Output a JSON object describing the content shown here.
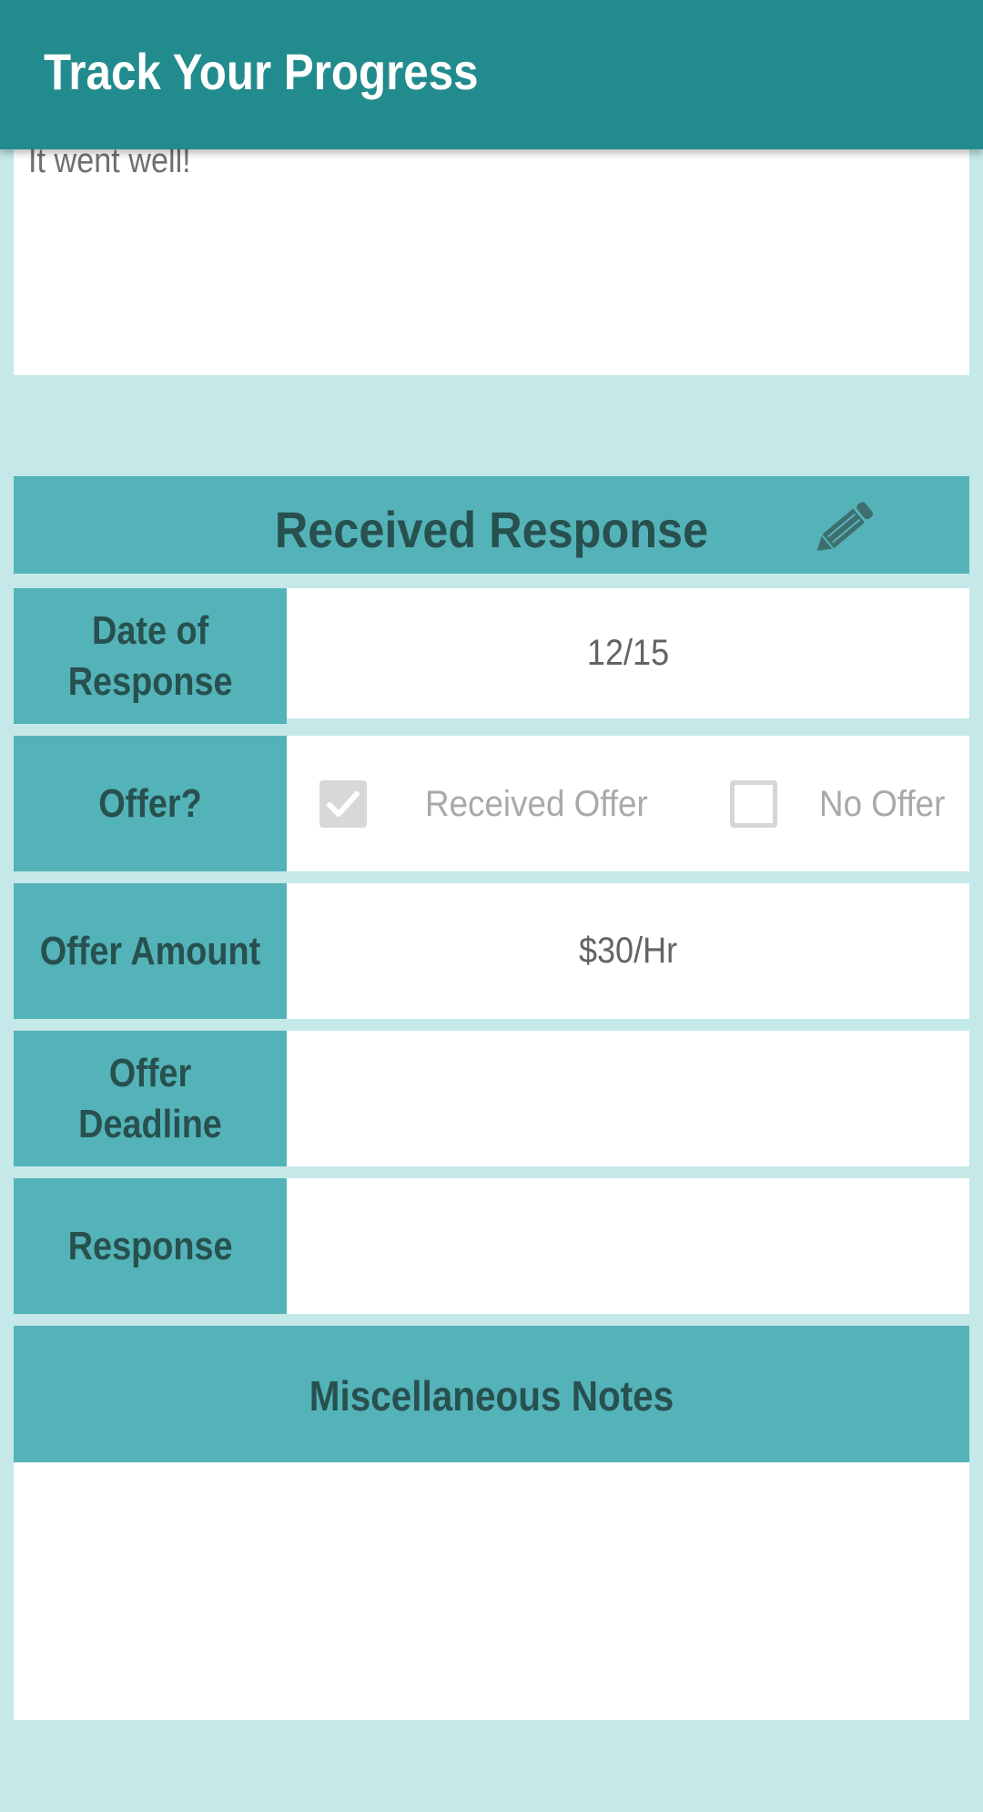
{
  "app_bar": {
    "title": "Track Your Progress"
  },
  "interview_notes": {
    "text": "It went well!"
  },
  "received_response": {
    "title": "Received Response",
    "edit_icon": "pencil-icon",
    "rows": {
      "date": {
        "label": "Date of\nResponse",
        "value": "12/15"
      },
      "offer": {
        "label": "Offer?",
        "received_offer_label": "Received Offer",
        "received_offer_checked": true,
        "no_offer_label": "No Offer",
        "no_offer_checked": false
      },
      "amount": {
        "label": "Offer Amount",
        "value": "$30/Hr"
      },
      "deadline": {
        "label": "Offer Deadline",
        "value": ""
      },
      "response": {
        "label": "Response",
        "value": ""
      }
    }
  },
  "misc_notes": {
    "title": "Miscellaneous Notes",
    "text": ""
  },
  "colors": {
    "app_bar": "#218b8d",
    "background": "#c5e8e8",
    "section": "#54b3b8",
    "label_text": "#27504f"
  }
}
